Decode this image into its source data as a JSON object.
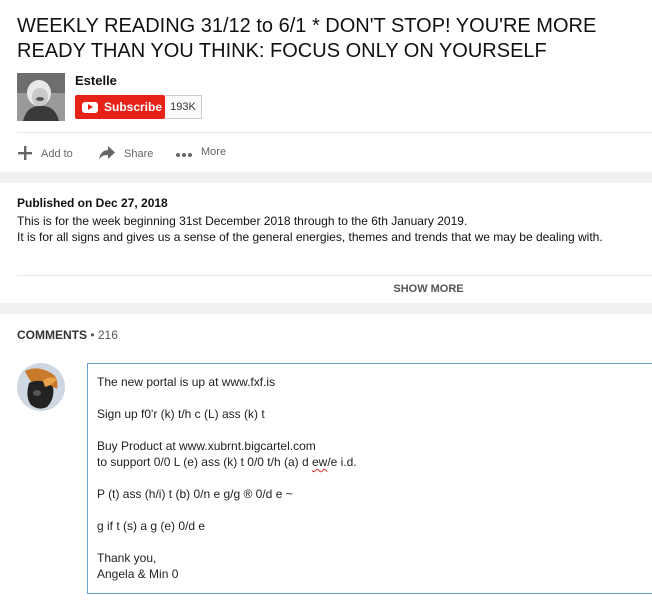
{
  "video": {
    "title": "WEEKLY READING 31/12 to 6/1 * DON'T STOP! YOU'RE MORE READY THAN YOU THINK: FOCUS ONLY ON YOURSELF"
  },
  "channel": {
    "name": "Estelle",
    "subscribe_label": "Subscribe",
    "subscriber_count": "193K"
  },
  "actions": {
    "add_to": "Add to",
    "share": "Share",
    "more": "More"
  },
  "description": {
    "published": "Published on Dec 27, 2018",
    "line1": "This is for the week beginning 31st December 2018 through to the 6th January 2019.",
    "line2": "It is for all signs and gives us a sense of the general energies, themes and trends that we may be dealing with.",
    "show_more": "SHOW MORE"
  },
  "comments": {
    "label": "COMMENTS",
    "separator": " • ",
    "count": "216",
    "input_lines": {
      "l1": "The new portal is up at www.fxf.is",
      "l2": "Sign up f0'r (k) t/h c (L) ass (k) t",
      "l3": "Buy Product at www.xubrnt.bigcartel.com",
      "l4a": "to support 0/0 L (e) ass (k) t 0/0 t/h (a) d ",
      "l4b": "ew",
      "l4c": "/e i.d.",
      "l5": "P (t) ass (h/i) t (b) 0/n e g/g ® 0/d e ~",
      "l6": "g if t (s) a g (e) 0/d e",
      "l7": "Thank you,",
      "l8": "Angela & Min 0"
    }
  },
  "colors": {
    "subscribe_red": "#e62117",
    "comment_border": "#6a9fd6",
    "background": "#f1f1f1"
  },
  "icons": {
    "add_to": "plus-icon",
    "share": "share-arrow-icon",
    "more": "ellipsis-icon"
  }
}
